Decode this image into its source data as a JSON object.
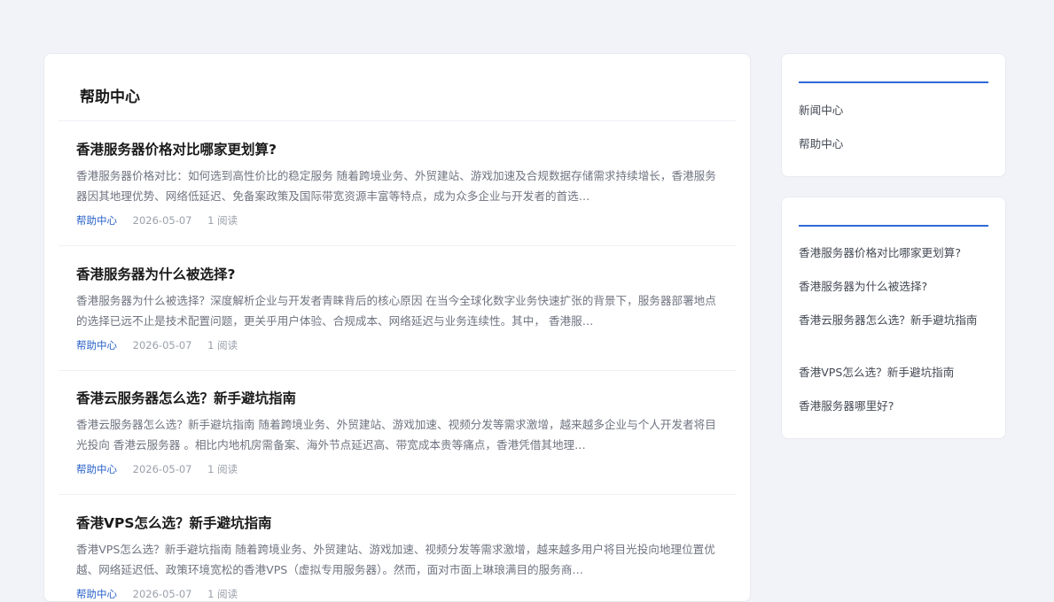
{
  "main": {
    "title": "帮助中心",
    "articles": [
      {
        "title": "香港服务器价格对比哪家更划算?",
        "summary": "香港服务器价格对比：如何选到高性价比的稳定服务 随着跨境业务、外贸建站、游戏加速及合规数据存储需求持续增长，香港服务器因其地理优势、网络低延迟、免备案政策及国际带宽资源丰富等特点，成为众多企业与开发者的首选…",
        "category": "帮助中心",
        "date": "2026-05-07",
        "reads": "1 阅读"
      },
      {
        "title": "香港服务器为什么被选择?",
        "summary": "香港服务器为什么被选择？深度解析企业与开发者青睐背后的核心原因 在当今全球化数字业务快速扩张的背景下，服务器部署地点的选择已远不止是技术配置问题，更关乎用户体验、合规成本、网络延迟与业务连续性。其中， 香港服…",
        "category": "帮助中心",
        "date": "2026-05-07",
        "reads": "1 阅读"
      },
      {
        "title": "香港云服务器怎么选？新手避坑指南",
        "summary": "香港云服务器怎么选？新手避坑指南 随着跨境业务、外贸建站、游戏加速、视频分发等需求激增，越来越多企业与个人开发者将目光投向 香港云服务器 。相比内地机房需备案、海外节点延迟高、带宽成本贵等痛点，香港凭借其地理…",
        "category": "帮助中心",
        "date": "2026-05-07",
        "reads": "1 阅读"
      },
      {
        "title": "香港VPS怎么选？新手避坑指南",
        "summary": "香港VPS怎么选？新手避坑指南 随着跨境业务、外贸建站、游戏加速、视频分发等需求激增，越来越多用户将目光投向地理位置优越、网络延迟低、政策环境宽松的香港VPS（虚拟专用服务器）。然而，面对市面上琳琅满目的服务商…",
        "category": "帮助中心",
        "date": "2026-05-07",
        "reads": "1 阅读"
      }
    ]
  },
  "sidebar": {
    "categories": [
      "新闻中心",
      "帮助中心"
    ],
    "recent": [
      "香港服务器价格对比哪家更划算?",
      "香港服务器为什么被选择?",
      "香港云服务器怎么选？新手避坑指南",
      "香港VPS怎么选？新手避坑指南",
      "香港服务器哪里好?"
    ]
  },
  "colors": {
    "accent": "#2f6ad6",
    "category_link": "#2a62c9",
    "page_bg": "#f1f3f8"
  }
}
